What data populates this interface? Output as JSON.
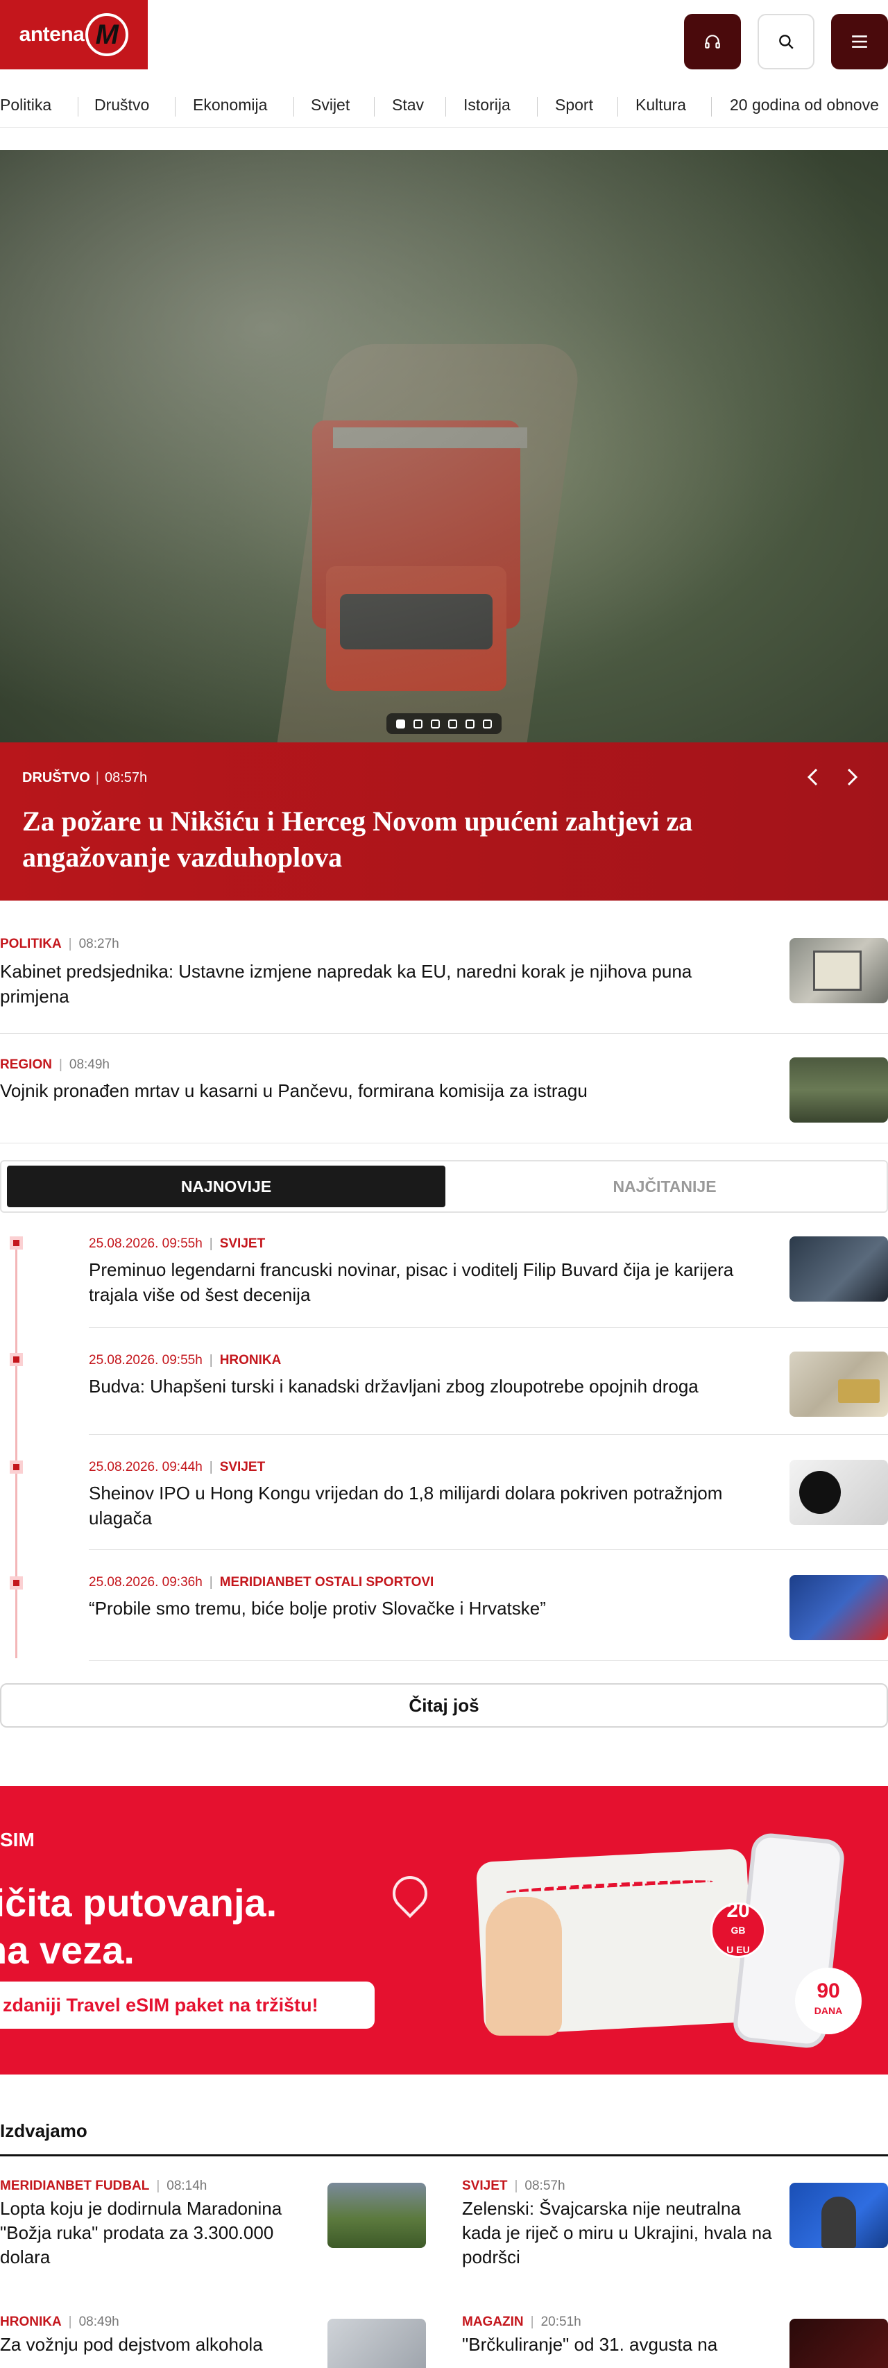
{
  "header": {
    "logo_text": "antena",
    "logo_letter": "M",
    "audio_icon": "headphones-icon",
    "search_icon": "search-icon",
    "menu_icon": "menu-icon"
  },
  "nav": {
    "items": [
      "Politika",
      "Društvo",
      "Ekonomija",
      "Svijet",
      "Stav",
      "Istorija",
      "Sport",
      "Kultura",
      "20 godina od obnove"
    ]
  },
  "hero": {
    "category": "DRUŠTVO",
    "time": "08:57h",
    "title": "Za požare u Nikšiću i Herceg Novom upućeni zahtjevi za angažovanje vazduhoplova",
    "slides": 6,
    "active_slide": 1,
    "prev_icon": "chevron-left-icon",
    "next_icon": "chevron-right-icon"
  },
  "top_news": [
    {
      "category": "POLITIKA",
      "time": "08:27h",
      "title": "Kabinet predsjednika: Ustavne izmjene napredak ka EU, naredni korak je njihova puna primjena"
    },
    {
      "category": "REGION",
      "time": "08:49h",
      "title": "Vojnik pronađen mrtav u kasarni u Pančevu, formirana komisija za istragu"
    }
  ],
  "tabs": {
    "active": "NAJNOVIJE",
    "inactive": "NAJČITANIJE"
  },
  "latest": [
    {
      "date": "25.08.2026. 09:55h",
      "category": "SVIJET",
      "title": "Preminuo legendarni francuski novinar, pisac i voditelj Filip Buvard čija je karijera trajala više od šest decenija"
    },
    {
      "date": "25.08.2026. 09:55h",
      "category": "HRONIKA",
      "title": "Budva: Uhapšeni turski i kanadski državljani zbog zloupotrebe opojnih droga"
    },
    {
      "date": "25.08.2026. 09:44h",
      "category": "SVIJET",
      "title": "Sheinov IPO u Hong Kongu vrijedan do 1,8 milijardi dolara pokriven potražnjom ulagača"
    },
    {
      "date": "25.08.2026. 09:36h",
      "category": "MERIDIANBET OSTALI SPORTOVI",
      "title": "“Probile smo tremu, biće bolje protiv Slovačke i Hrvatske”"
    }
  ],
  "readmore_label": "Čitaj još",
  "banner": {
    "small": "SIM",
    "line1": "ličita putovanja.",
    "line2": "na veza.",
    "pill": "zdaniji Travel eSIM paket na tržištu!",
    "badge1_value": "20",
    "badge1_unit": "GB",
    "badge1_sub": "U EU",
    "badge2_value": "90",
    "badge2_unit": "DANA"
  },
  "featured": {
    "title": "Izdvajamo",
    "cards": [
      {
        "category": "MERIDIANBET FUDBAL",
        "time": "08:14h",
        "title": "Lopta koju je dodirnula Maradonina \"Božja ruka\" prodata za 3.300.000 dolara"
      },
      {
        "category": "SVIJET",
        "time": "08:57h",
        "title": "Zelenski: Švajcarska nije neutralna kada je riječ o miru u Ukrajini, hvala na podršci"
      },
      {
        "category": "HRONIKA",
        "time": "08:49h",
        "title": "Za vožnju pod dejstvom alkohola"
      },
      {
        "category": "MAGAZIN",
        "time": "20:51h",
        "title": "\"Brčkuliranje\" od 31. avgusta na"
      }
    ]
  }
}
